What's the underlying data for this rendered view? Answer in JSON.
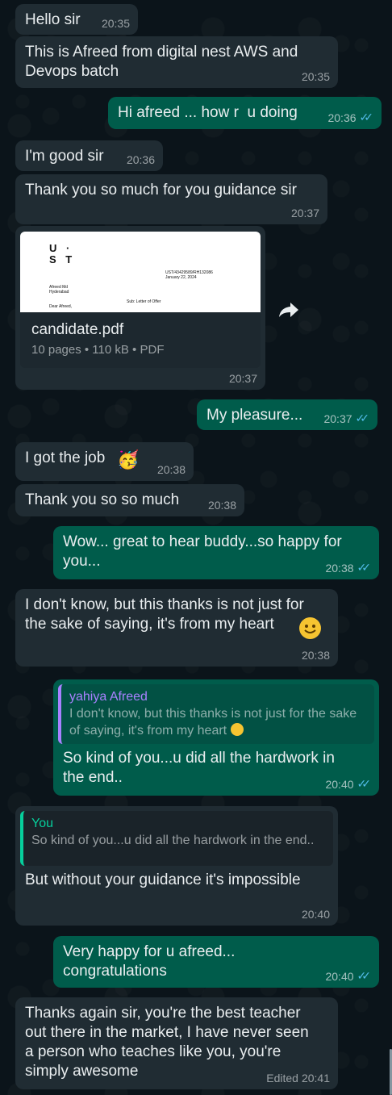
{
  "messages": [
    {
      "text": "Hello sir",
      "time": "20:35"
    },
    {
      "text": "This is Afreed from digital nest AWS and\nDevops batch",
      "time": "20:35"
    },
    {
      "text": "Hi afreed ... how r  u doing",
      "time": "20:36"
    },
    {
      "text": "I'm good sir",
      "time": "20:36"
    },
    {
      "text": "Thank you so much for you guidance sir",
      "time": "20:37"
    },
    {
      "text": "My pleasure...",
      "time": "20:37"
    },
    {
      "text": "I got the job",
      "emoji": "🥳",
      "time": "20:38"
    },
    {
      "text": "Thank you so so much",
      "time": "20:38"
    },
    {
      "text": "Wow... great to hear buddy...so happy for\nyou...",
      "time": "20:38"
    },
    {
      "text": "I don't know, but this thanks is not just for\nthe sake of saying, it's from my heart",
      "time": "20:38"
    },
    {
      "text": "So kind of you...u did all the hardwork in\nthe end..",
      "time": "20:40",
      "quote_name": "yahiya Afreed",
      "quote_text": "I don't know, but this thanks is not just for the sake of saying, it's from my heart"
    },
    {
      "text": "But without your guidance it's impossible",
      "time": "20:40",
      "quote_name": "You",
      "quote_text": "So kind of you...u did all the hardwork in the end.."
    },
    {
      "text": "Very happy for u afreed...\ncongratulations",
      "time": "20:40"
    },
    {
      "text": "Thanks again sir, you're the best teacher\nout there in the market, I have never seen\na person who teaches like you, you're\nsimply awesome",
      "time": "20:41",
      "edited_label": "Edited"
    }
  ],
  "document": {
    "name": "candidate.pdf",
    "meta": "10 pages • 110 kB • PDF",
    "time": "20:37",
    "logo_top": "U  ·",
    "logo_bottom": "S T",
    "ref": "UST/43429589/RH132086",
    "date": "January 22, 2024",
    "addr1": "Afreed Md",
    "addr2": "Hyderabad",
    "subject": "Sub: Letter of Offer",
    "salutation": "Dear Afreed,"
  },
  "colors": {
    "incoming_bubble": "#202c33",
    "outgoing_bubble": "#005c4b",
    "read_ticks": "#53bdeb",
    "quote_other": "#a881ff",
    "quote_you": "#06cf9c"
  }
}
